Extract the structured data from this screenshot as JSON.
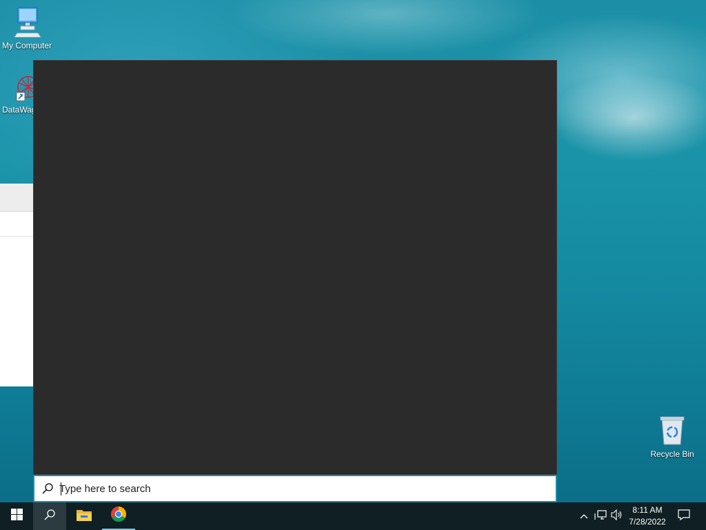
{
  "desktop": {
    "icons": [
      {
        "label": "My Computer",
        "icon": "computer-icon"
      },
      {
        "label": "DataWag",
        "icon": "datawag-shortcut-icon"
      },
      {
        "label": "Recycle Bin",
        "icon": "recycle-bin-icon"
      }
    ]
  },
  "search": {
    "placeholder": "Type here to search",
    "value": ""
  },
  "taskbar": {
    "start": {
      "icon": "windows-logo-icon"
    },
    "search_button": {
      "icon": "search-icon"
    },
    "pinned": [
      {
        "name": "File Explorer",
        "icon": "file-explorer-icon"
      },
      {
        "name": "Google Chrome",
        "icon": "chrome-icon"
      }
    ],
    "tray": {
      "icons": [
        "chevron-up-icon",
        "network-icon",
        "volume-icon"
      ],
      "time": "8:11 AM",
      "date": "7/28/2022",
      "notifications_icon": "action-center-icon"
    }
  },
  "colors": {
    "taskbar_bg": "#0f1f24",
    "search_panel_bg": "#2b2b2b",
    "search_border": "#1a8fa8",
    "running_indicator": "#7fc7d9"
  }
}
